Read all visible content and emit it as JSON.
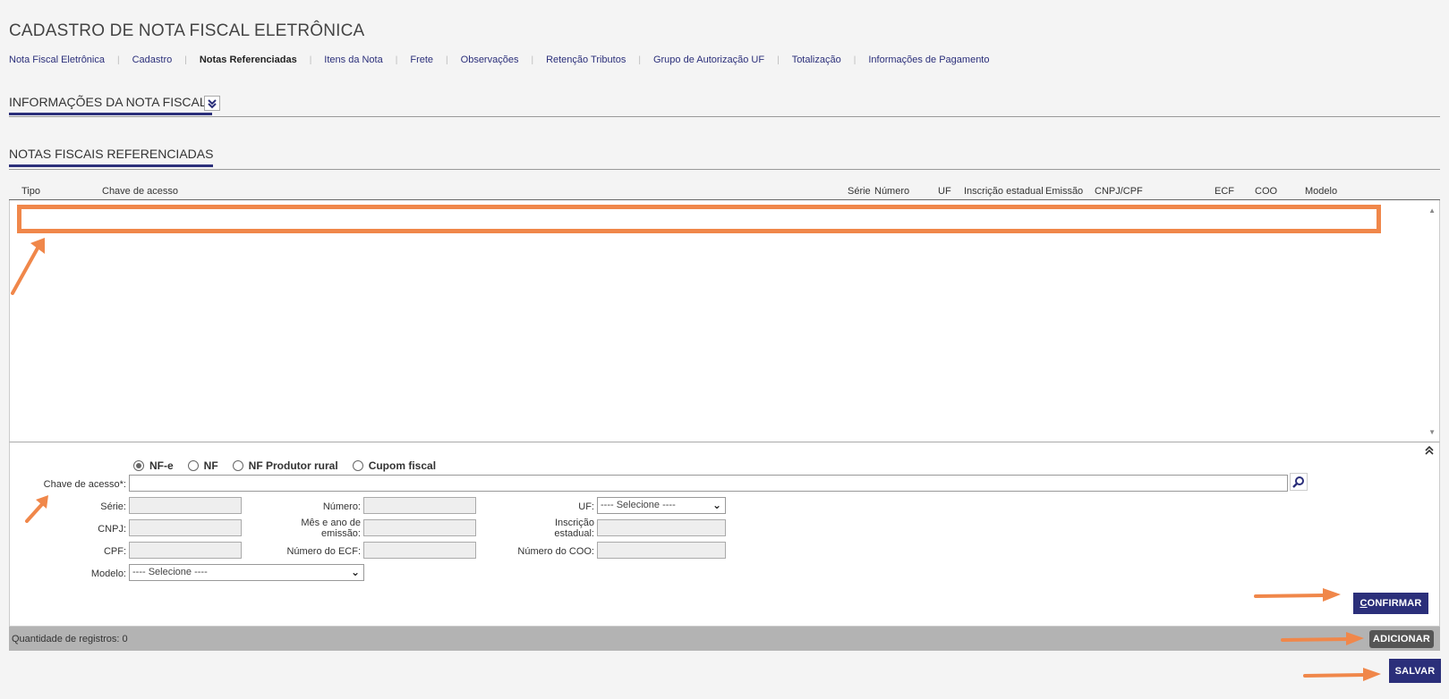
{
  "page": {
    "title": "CADASTRO DE NOTA FISCAL ELETRÔNICA"
  },
  "tabs": [
    {
      "label": "Nota Fiscal Eletrônica",
      "active": false
    },
    {
      "label": "Cadastro",
      "active": false
    },
    {
      "label": "Notas Referenciadas",
      "active": true
    },
    {
      "label": "Itens da Nota",
      "active": false
    },
    {
      "label": "Frete",
      "active": false
    },
    {
      "label": "Observações",
      "active": false
    },
    {
      "label": "Retenção Tributos",
      "active": false
    },
    {
      "label": "Grupo de Autorização UF",
      "active": false
    },
    {
      "label": "Totalização",
      "active": false
    },
    {
      "label": "Informações de Pagamento",
      "active": false
    }
  ],
  "sections": {
    "info": "INFORMAÇÕES DA NOTA FISCAL",
    "refs": "NOTAS FISCAIS REFERENCIADAS"
  },
  "grid": {
    "columns": [
      "Tipo",
      "Chave de acesso",
      "Série",
      "Número",
      "UF",
      "Inscrição estadual",
      "Emissão",
      "CNPJ/CPF",
      "ECF",
      "COO",
      "Modelo"
    ],
    "rows": []
  },
  "form": {
    "radios": [
      {
        "label": "NF-e",
        "checked": true
      },
      {
        "label": "NF",
        "checked": false
      },
      {
        "label": "NF Produtor rural",
        "checked": false
      },
      {
        "label": "Cupom fiscal",
        "checked": false
      }
    ],
    "chave_label": "Chave de acesso*:",
    "serie_label": "Série:",
    "numero_label": "Número:",
    "uf_label": "UF:",
    "uf_value": "---- Selecione ----",
    "cnpj_label": "CNPJ:",
    "mes_ano_label_1": "Mês e ano de",
    "mes_ano_label_2": "emissão:",
    "inscricao_label_1": "Inscrição",
    "inscricao_label_2": "estadual:",
    "cpf_label": "CPF:",
    "ecf_label": "Número do ECF:",
    "coo_label": "Número do COO:",
    "modelo_label": "Modelo:",
    "modelo_value": "---- Selecione ----"
  },
  "buttons": {
    "confirm_first": "C",
    "confirm_rest": "ONFIRMAR",
    "add": "ADICIONAR",
    "save": "SALVAR"
  },
  "status": {
    "count": "Quantidade de registros: 0"
  },
  "colors": {
    "primary": "#2b2f7a",
    "annotation": "#f0874a",
    "status_bar": "#b3b3b3"
  }
}
